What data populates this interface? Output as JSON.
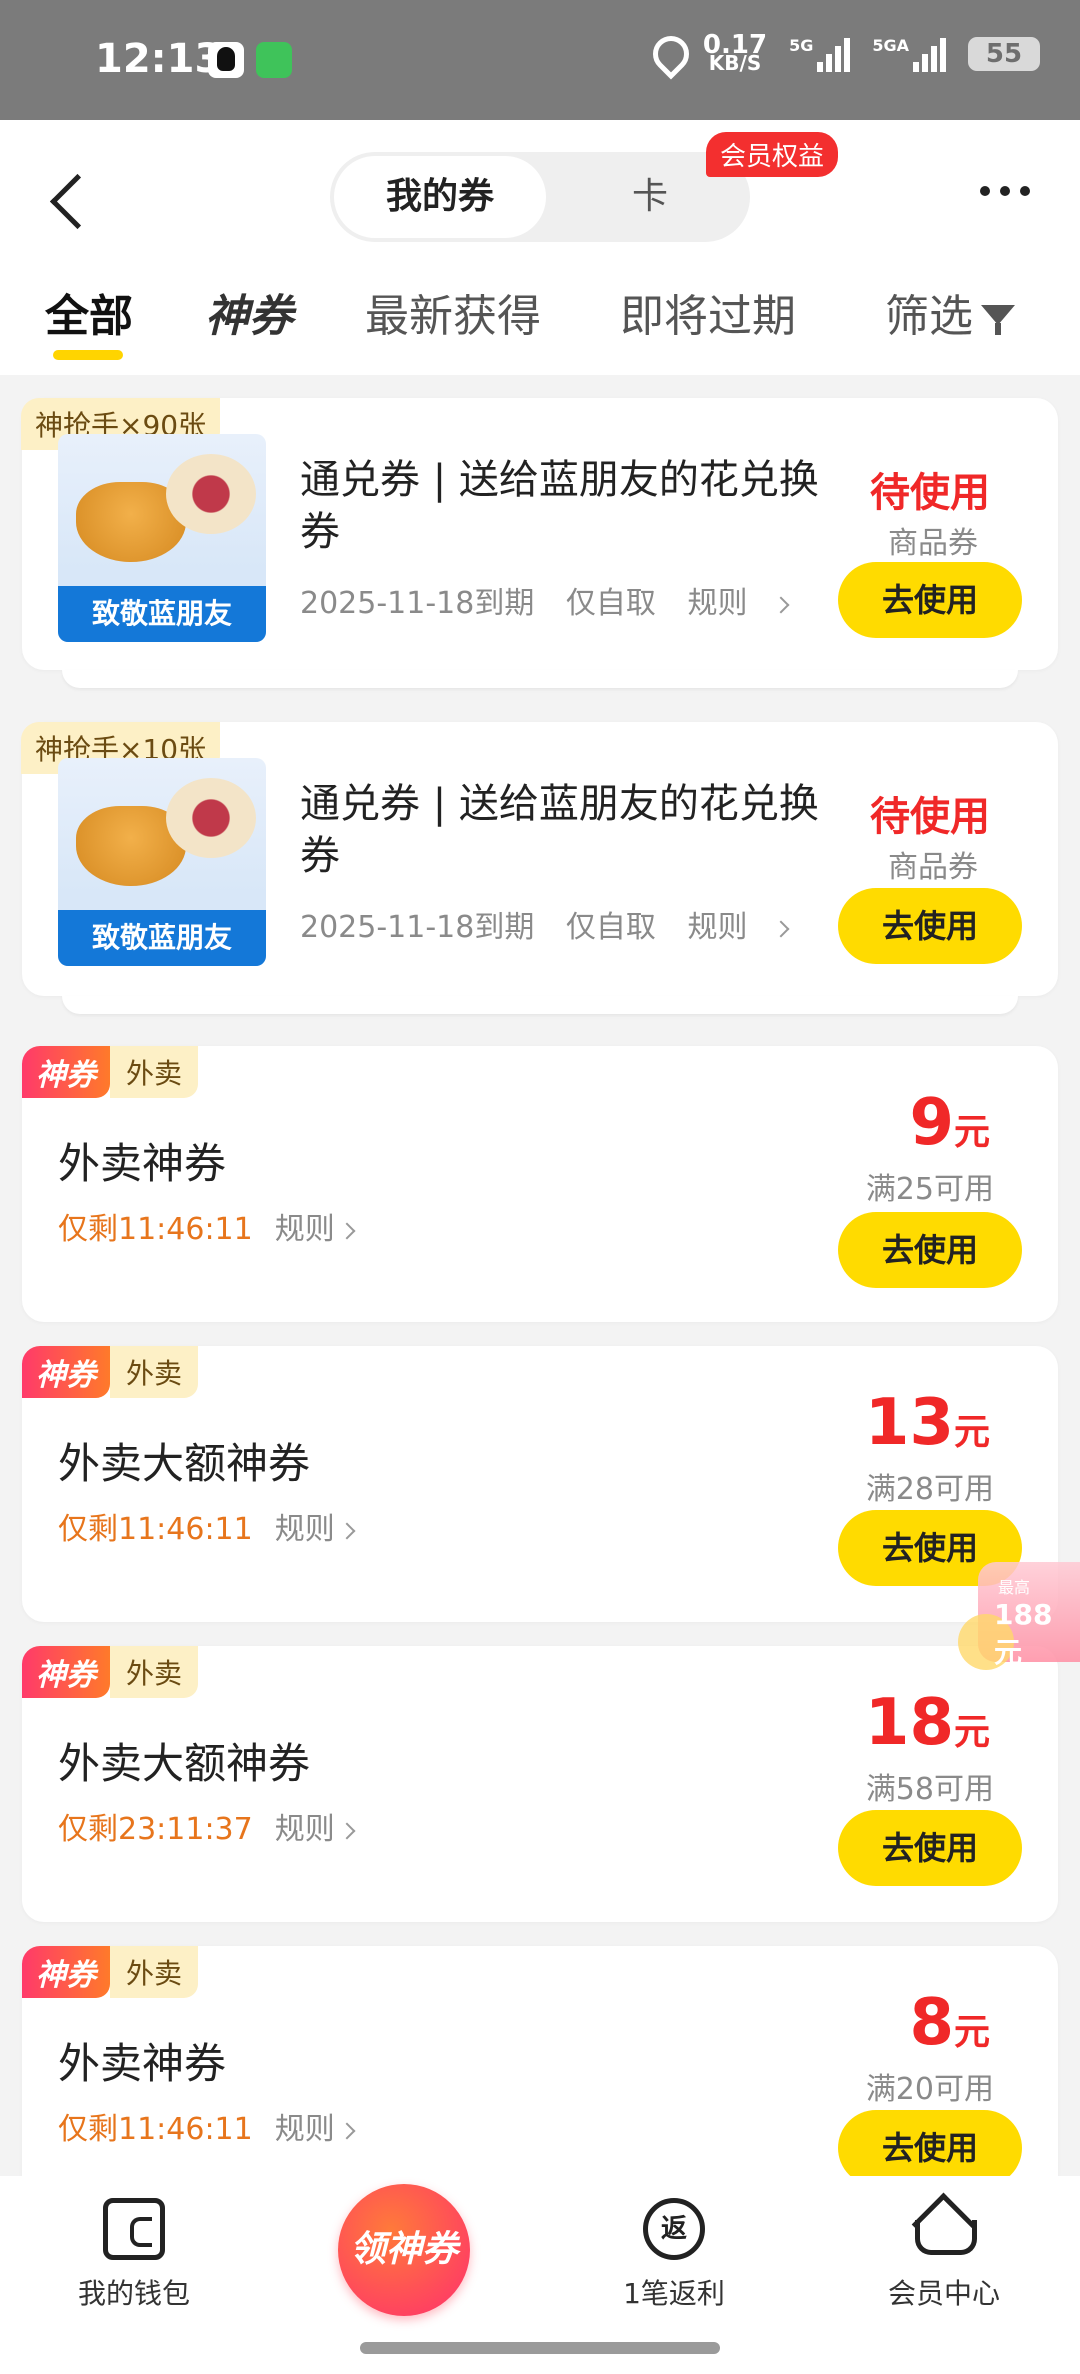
{
  "status_bar": {
    "time": "12:13",
    "net_speed_value": "0.17",
    "net_speed_unit": "KB/S",
    "sim1": "5G",
    "sim2": "5GA",
    "battery": "55"
  },
  "header": {
    "segment_active": "我的券",
    "segment_inactive": "卡",
    "vip_badge": "会员权益"
  },
  "tabs": [
    {
      "label": "全部",
      "active": true
    },
    {
      "label": "神券",
      "active": false
    },
    {
      "label": "最新获得",
      "active": false
    },
    {
      "label": "即将过期",
      "active": false
    },
    {
      "label": "筛选",
      "active": false
    }
  ],
  "voucher_cards": [
    {
      "count_tag": "神抢手×90张",
      "thumb_text": "致敬蓝朋友",
      "title": "通兑券 | 送给蓝朋友的花兑换券",
      "expire": "2025-11-18到期",
      "pickup": "仅自取",
      "rule": "规则",
      "status": "待使用",
      "subtype": "商品券",
      "button": "去使用"
    },
    {
      "count_tag": "神抢手×10张",
      "thumb_text": "致敬蓝朋友",
      "title": "通兑券 | 送给蓝朋友的花兑换券",
      "expire": "2025-11-18到期",
      "pickup": "仅自取",
      "rule": "规则",
      "status": "待使用",
      "subtype": "商品券",
      "button": "去使用"
    }
  ],
  "coupons": [
    {
      "tag1": "神券",
      "tag2": "外卖",
      "title": "外卖神券",
      "remain": "仅剩11:46:11",
      "rule": "规则",
      "amount": "9",
      "unit": "元",
      "condition": "满25可用",
      "button": "去使用"
    },
    {
      "tag1": "神券",
      "tag2": "外卖",
      "title": "外卖大额神券",
      "remain": "仅剩11:46:11",
      "rule": "规则",
      "amount": "13",
      "unit": "元",
      "condition": "满28可用",
      "button": "去使用"
    },
    {
      "tag1": "神券",
      "tag2": "外卖",
      "title": "外卖大额神券",
      "remain": "仅剩23:11:37",
      "rule": "规则",
      "amount": "18",
      "unit": "元",
      "condition": "满58可用",
      "button": "去使用"
    },
    {
      "tag1": "神券",
      "tag2": "外卖",
      "title": "外卖神券",
      "remain": "仅剩11:46:11",
      "rule": "规则",
      "amount": "8",
      "unit": "元",
      "condition": "满20可用",
      "button": "去使用"
    }
  ],
  "float_widget": {
    "line1": "最高",
    "line2": "188元"
  },
  "bottom_nav": {
    "wallet": "我的钱包",
    "center": "领神券",
    "rebate_icon": "返",
    "rebate": "1笔返利",
    "member": "会员中心"
  },
  "colors": {
    "accent_yellow": "#ffdb00",
    "price_red": "#f02828",
    "countdown_orange": "#e7751c",
    "status_bar_gray": "#7b7b7b"
  }
}
